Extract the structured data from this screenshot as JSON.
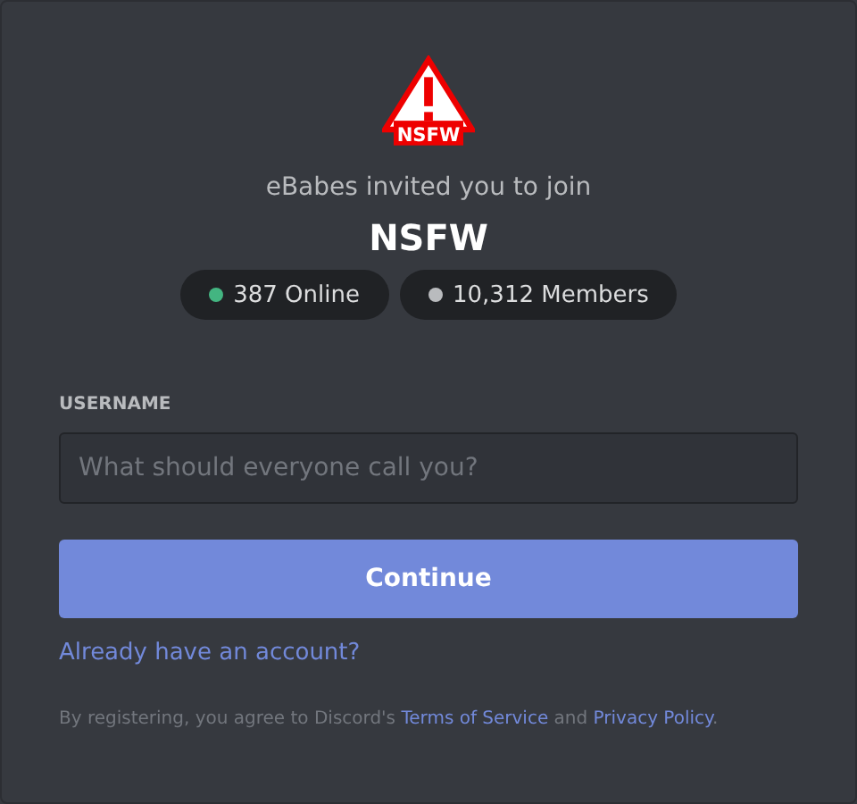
{
  "server": {
    "logo_text": "NSFW",
    "invite_text": "eBabes invited you to join",
    "name": "NSFW"
  },
  "stats": [
    {
      "label": "387 Online",
      "color": "#43b581"
    },
    {
      "label": "10,312 Members",
      "color": "#b9bbbe"
    }
  ],
  "form": {
    "label": "USERNAME",
    "placeholder": "What should everyone call you?",
    "button": "Continue",
    "account_link": "Already have an account?"
  },
  "legal": {
    "before": "By registering, you agree to Discord's ",
    "terms": "Terms of Service",
    "middle": " and ",
    "privacy": "Privacy Policy",
    "after": "."
  }
}
